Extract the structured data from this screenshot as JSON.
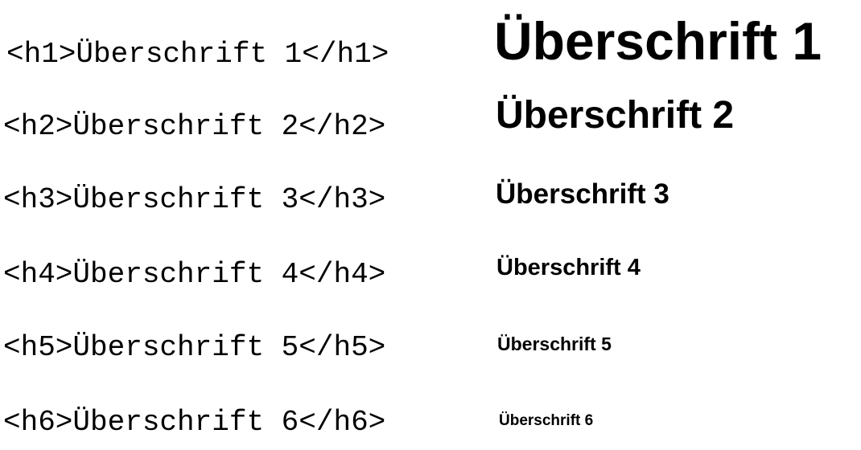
{
  "rows": [
    {
      "code": "<h1>Überschrift 1</h1>",
      "rendered": "Überschrift 1"
    },
    {
      "code": "<h2>Überschrift 2</h2>",
      "rendered": "Überschrift 2"
    },
    {
      "code": "<h3>Überschrift 3</h3>",
      "rendered": "Überschrift 3"
    },
    {
      "code": "<h4>Überschrift 4</h4>",
      "rendered": "Überschrift 4"
    },
    {
      "code": "<h5>Überschrift 5</h5>",
      "rendered": "Überschrift 5"
    },
    {
      "code": "<h6>Überschrift 6</h6>",
      "rendered": "Überschrift 6"
    }
  ]
}
